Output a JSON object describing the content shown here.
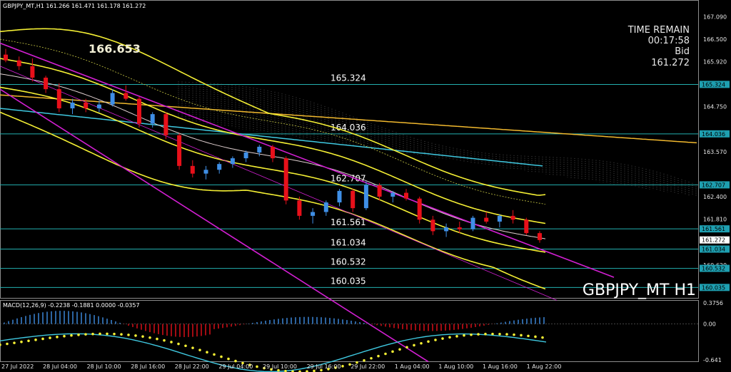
{
  "header": {
    "symbol_tf": "GBPJPY_MT,H1",
    "ohlc": "161.266 161.471 161.178 161.272"
  },
  "info": {
    "time_remain_label": "TIME REMAIN",
    "time_remain": "00:17:58",
    "bid_label": "Bid",
    "bid": "161.272"
  },
  "watermark": "GBPJPY_MT H1",
  "high_label": "166.653",
  "colors": {
    "bull": "#3f8fe6",
    "bear": "#e8101a",
    "level": "#23b0b0",
    "channel": "#d21fd2",
    "band": "#f4ef34",
    "slow": "#f2b92e",
    "cyan": "#3fc8e0",
    "price_tag": "#1e9fb0"
  },
  "chart_data": {
    "type": "candlestick",
    "price_axis": {
      "min": 160.035,
      "max": 167.2,
      "ticks": [
        "167.090",
        "166.500",
        "165.920",
        "165.324",
        "164.750",
        "164.036",
        "163.570",
        "162.707",
        "162.400",
        "161.561",
        "161.810",
        "161.272",
        "160.620",
        "161.034",
        "160.532",
        "160.035"
      ]
    },
    "levels": [
      {
        "value": 165.324,
        "label": "165.324"
      },
      {
        "value": 164.036,
        "label": "164.036"
      },
      {
        "value": 162.707,
        "label": "162.707"
      },
      {
        "value": 161.561,
        "label": "161.561"
      },
      {
        "value": 161.034,
        "label": "161.034"
      },
      {
        "value": 160.532,
        "label": "160.532"
      },
      {
        "value": 160.035,
        "label": "160.035"
      }
    ],
    "time_labels": [
      "27 Jul 2022",
      "28 Jul 04:00",
      "28 Jul 10:00",
      "28 Jul 16:00",
      "28 Jul 22:00",
      "29 Jul 04:00",
      "29 Jul 10:00",
      "29 Jul 16:00",
      "29 Jul 22:00",
      "1 Aug 04:00",
      "1 Aug 10:00",
      "1 Aug 16:00",
      "1 Aug 22:00"
    ],
    "candles": [
      [
        166.1,
        166.25,
        165.9,
        165.95
      ],
      [
        165.95,
        166.05,
        165.7,
        165.8
      ],
      [
        165.8,
        166.0,
        165.4,
        165.5
      ],
      [
        165.5,
        165.55,
        165.1,
        165.2
      ],
      [
        165.2,
        165.35,
        164.6,
        164.7
      ],
      [
        164.7,
        164.95,
        164.55,
        164.85
      ],
      [
        164.85,
        164.95,
        164.6,
        164.7
      ],
      [
        164.7,
        164.9,
        164.6,
        164.8
      ],
      [
        164.8,
        165.2,
        164.75,
        165.1
      ],
      [
        165.1,
        165.3,
        164.9,
        164.95
      ],
      [
        164.95,
        165.0,
        164.2,
        164.3
      ],
      [
        164.3,
        164.6,
        164.2,
        164.55
      ],
      [
        164.55,
        164.6,
        163.9,
        164.0
      ],
      [
        164.0,
        164.05,
        163.1,
        163.2
      ],
      [
        163.2,
        163.35,
        162.9,
        163.0
      ],
      [
        163.0,
        163.2,
        162.85,
        163.1
      ],
      [
        163.1,
        163.3,
        163.0,
        163.25
      ],
      [
        163.25,
        163.45,
        163.15,
        163.4
      ],
      [
        163.4,
        163.6,
        163.3,
        163.55
      ],
      [
        163.55,
        163.75,
        163.45,
        163.7
      ],
      [
        163.7,
        163.75,
        163.3,
        163.4
      ],
      [
        163.4,
        163.45,
        162.2,
        162.3
      ],
      [
        162.3,
        162.4,
        161.8,
        161.9
      ],
      [
        161.9,
        162.1,
        161.7,
        162.0
      ],
      [
        162.0,
        162.3,
        161.9,
        162.25
      ],
      [
        162.25,
        162.6,
        162.15,
        162.55
      ],
      [
        162.55,
        162.6,
        162.0,
        162.1
      ],
      [
        162.1,
        162.8,
        162.05,
        162.7
      ],
      [
        162.7,
        162.75,
        162.3,
        162.4
      ],
      [
        162.4,
        162.55,
        162.25,
        162.5
      ],
      [
        162.5,
        162.6,
        162.3,
        162.35
      ],
      [
        162.35,
        162.4,
        161.7,
        161.8
      ],
      [
        161.8,
        161.9,
        161.4,
        161.5
      ],
      [
        161.5,
        161.7,
        161.35,
        161.6
      ],
      [
        161.6,
        161.75,
        161.45,
        161.55
      ],
      [
        161.55,
        161.9,
        161.5,
        161.85
      ],
      [
        161.85,
        162.0,
        161.7,
        161.75
      ],
      [
        161.75,
        161.95,
        161.6,
        161.9
      ],
      [
        161.9,
        162.05,
        161.7,
        161.8
      ],
      [
        161.8,
        161.85,
        161.4,
        161.45
      ],
      [
        161.45,
        161.5,
        161.2,
        161.27
      ]
    ],
    "channel": [
      {
        "name": "",
        "top_start": 166.4,
        "top_end": 160.3,
        "bottom_start": 165.2,
        "bottom_end": 158.1
      }
    ],
    "macd": {
      "label": "MACD(12,26,9) -0.2238 -0.1881 0.0000 -0.0357",
      "ticks": [
        "0.3756",
        "0.00",
        "-0.641"
      ],
      "min": -0.641,
      "max": 0.3756
    }
  },
  "price_tags": [
    {
      "value": 165.324,
      "label": "165.324"
    },
    {
      "value": 164.036,
      "label": "164.036"
    },
    {
      "value": 162.707,
      "label": "162.707"
    },
    {
      "value": 161.561,
      "label": "161.561"
    },
    {
      "value": 161.272,
      "label": "161.272"
    },
    {
      "value": 161.034,
      "label": "161.034"
    },
    {
      "value": 160.532,
      "label": "160.532"
    },
    {
      "value": 160.035,
      "label": "160.035"
    }
  ]
}
